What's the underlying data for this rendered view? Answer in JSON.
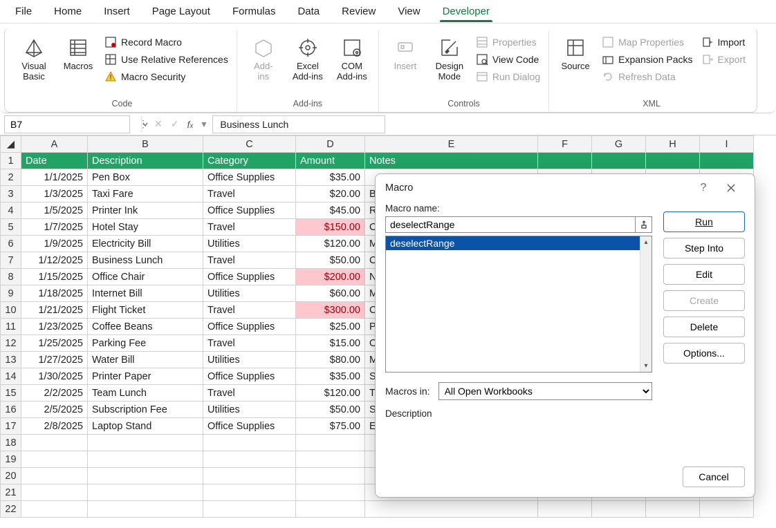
{
  "menu": [
    "File",
    "Home",
    "Insert",
    "Page Layout",
    "Formulas",
    "Data",
    "Review",
    "View",
    "Developer"
  ],
  "menu_active": 8,
  "ribbon": {
    "code": {
      "visual_basic": "Visual\nBasic",
      "macros": "Macros",
      "record_macro": "Record Macro",
      "use_relative": "Use Relative References",
      "macro_security": "Macro Security",
      "label": "Code"
    },
    "addins": {
      "add_ins": "Add-\nins",
      "excel_addins": "Excel\nAdd-ins",
      "com_addins": "COM\nAdd-ins",
      "label": "Add-ins"
    },
    "controls": {
      "insert": "Insert",
      "design_mode": "Design\nMode",
      "properties": "Properties",
      "view_code": "View Code",
      "run_dialog": "Run Dialog",
      "label": "Controls"
    },
    "xml": {
      "source": "Source",
      "map_props": "Map Properties",
      "expansion": "Expansion Packs",
      "refresh": "Refresh Data",
      "import": "Import",
      "export": "Export",
      "label": "XML"
    }
  },
  "namebox": "B7",
  "formula": "Business Lunch",
  "columns": [
    "A",
    "B",
    "C",
    "D",
    "E",
    "F",
    "G",
    "H",
    "I"
  ],
  "headers": [
    "Date",
    "Description",
    "Category",
    "Amount",
    "Notes"
  ],
  "rows": [
    {
      "n": 2,
      "d": "1/1/2025",
      "desc": "Pen Box",
      "cat": "Office Supplies",
      "amt": "$35.00",
      "note": "",
      "red": false
    },
    {
      "n": 3,
      "d": "1/3/2025",
      "desc": "Taxi Fare",
      "cat": "Travel",
      "amt": "$20.00",
      "note": "B",
      "red": false
    },
    {
      "n": 4,
      "d": "1/5/2025",
      "desc": "Printer Ink",
      "cat": "Office Supplies",
      "amt": "$45.00",
      "note": "R",
      "red": false
    },
    {
      "n": 5,
      "d": "1/7/2025",
      "desc": "Hotel Stay",
      "cat": "Travel",
      "amt": "$150.00",
      "note": "C",
      "red": true
    },
    {
      "n": 6,
      "d": "1/9/2025",
      "desc": "Electricity Bill",
      "cat": "Utilities",
      "amt": "$120.00",
      "note": "M",
      "red": false
    },
    {
      "n": 7,
      "d": "1/12/2025",
      "desc": "Business Lunch",
      "cat": "Travel",
      "amt": "$50.00",
      "note": "C",
      "red": false
    },
    {
      "n": 8,
      "d": "1/15/2025",
      "desc": "Office Chair",
      "cat": "Office Supplies",
      "amt": "$200.00",
      "note": "N",
      "red": true
    },
    {
      "n": 9,
      "d": "1/18/2025",
      "desc": "Internet Bill",
      "cat": "Utilities",
      "amt": "$60.00",
      "note": "M",
      "red": false
    },
    {
      "n": 10,
      "d": "1/21/2025",
      "desc": "Flight Ticket",
      "cat": "Travel",
      "amt": "$300.00",
      "note": "C",
      "red": true
    },
    {
      "n": 11,
      "d": "1/23/2025",
      "desc": "Coffee Beans",
      "cat": "Office Supplies",
      "amt": "$25.00",
      "note": "P",
      "red": false
    },
    {
      "n": 12,
      "d": "1/25/2025",
      "desc": "Parking Fee",
      "cat": "Travel",
      "amt": "$15.00",
      "note": "O",
      "red": false
    },
    {
      "n": 13,
      "d": "1/27/2025",
      "desc": "Water Bill",
      "cat": "Utilities",
      "amt": "$80.00",
      "note": "M",
      "red": false
    },
    {
      "n": 14,
      "d": "1/30/2025",
      "desc": "Printer Paper",
      "cat": "Office Supplies",
      "amt": "$35.00",
      "note": "S",
      "red": false
    },
    {
      "n": 15,
      "d": "2/2/2025",
      "desc": "Team Lunch",
      "cat": "Travel",
      "amt": "$120.00",
      "note": "T",
      "red": false
    },
    {
      "n": 16,
      "d": "2/5/2025",
      "desc": "Subscription Fee",
      "cat": "Utilities",
      "amt": "$50.00",
      "note": "S",
      "red": false
    },
    {
      "n": 17,
      "d": "2/8/2025",
      "desc": "Laptop Stand",
      "cat": "Office Supplies",
      "amt": "$75.00",
      "note": "E",
      "red": false
    }
  ],
  "empty_rows": [
    18,
    19,
    20,
    21,
    22
  ],
  "dialog": {
    "title": "Macro",
    "macro_name_label": "Macro name:",
    "macro_name_value": "deselectRange",
    "list": [
      "deselectRange"
    ],
    "macros_in_label": "Macros in:",
    "macros_in_value": "All Open Workbooks",
    "description_label": "Description",
    "buttons": {
      "run": "Run",
      "step_into": "Step Into",
      "edit": "Edit",
      "create": "Create",
      "delete": "Delete",
      "options": "Options...",
      "cancel": "Cancel"
    }
  }
}
